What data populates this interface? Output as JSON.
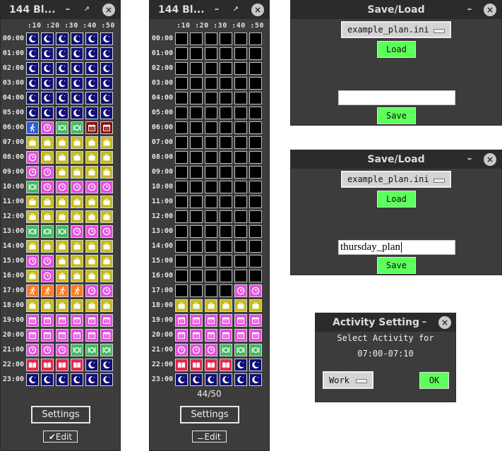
{
  "colors": {
    "sleep": "#0f0f7a",
    "work": "#c4bb1e",
    "free": "#e64fe0",
    "food": "#43b860",
    "exercise": "#ff7a22",
    "read": "#e8264f",
    "calendar": "#8a1010",
    "commute": "#2d5fd4",
    "empty": "#000000"
  },
  "activity_icons": {
    "sleep": "crescent-moon-icon",
    "work": "briefcase-icon",
    "free": "clock-icon",
    "food": "plate-icon",
    "exercise": "runner-icon",
    "read": "open-book-icon",
    "calendar": "calendar-icon",
    "commute": "walking-icon"
  },
  "left_window": {
    "title": "144 Bl...",
    "minimize": "–",
    "restore": "↗",
    "close": "×",
    "header": ":10 :20 :30 :40 :50",
    "settings_label": "Settings",
    "edit_label": "✔Edit",
    "rows": [
      {
        "hour": "00:00",
        "cells": [
          "sleep",
          "sleep",
          "sleep",
          "sleep",
          "sleep",
          "sleep"
        ]
      },
      {
        "hour": "01:00",
        "cells": [
          "sleep",
          "sleep",
          "sleep",
          "sleep",
          "sleep",
          "sleep"
        ]
      },
      {
        "hour": "02:00",
        "cells": [
          "sleep",
          "sleep",
          "sleep",
          "sleep",
          "sleep",
          "sleep"
        ]
      },
      {
        "hour": "03:00",
        "cells": [
          "sleep",
          "sleep",
          "sleep",
          "sleep",
          "sleep",
          "sleep"
        ]
      },
      {
        "hour": "04:00",
        "cells": [
          "sleep",
          "sleep",
          "sleep",
          "sleep",
          "sleep",
          "sleep"
        ]
      },
      {
        "hour": "05:00",
        "cells": [
          "sleep",
          "sleep",
          "sleep",
          "sleep",
          "sleep",
          "sleep"
        ]
      },
      {
        "hour": "06:00",
        "cells": [
          "commute",
          "free",
          "food",
          "food",
          "calendar",
          "calendar"
        ]
      },
      {
        "hour": "07:00",
        "cells": [
          "work",
          "work",
          "work",
          "work",
          "work",
          "work"
        ]
      },
      {
        "hour": "08:00",
        "cells": [
          "free",
          "work",
          "work",
          "work",
          "work",
          "work"
        ]
      },
      {
        "hour": "09:00",
        "cells": [
          "free",
          "free",
          "work",
          "work",
          "work",
          "work"
        ]
      },
      {
        "hour": "10:00",
        "cells": [
          "food",
          "free",
          "free",
          "free",
          "free",
          "free"
        ]
      },
      {
        "hour": "11:00",
        "cells": [
          "work",
          "work",
          "work",
          "work",
          "work",
          "work"
        ]
      },
      {
        "hour": "12:00",
        "cells": [
          "work",
          "work",
          "work",
          "work",
          "work",
          "work"
        ]
      },
      {
        "hour": "13:00",
        "cells": [
          "food",
          "food",
          "food",
          "free",
          "free",
          "free"
        ]
      },
      {
        "hour": "14:00",
        "cells": [
          "work",
          "work",
          "work",
          "work",
          "work",
          "work"
        ]
      },
      {
        "hour": "15:00",
        "cells": [
          "free",
          "free",
          "work",
          "work",
          "work",
          "work"
        ]
      },
      {
        "hour": "16:00",
        "cells": [
          "work",
          "free",
          "work",
          "work",
          "work",
          "work"
        ]
      },
      {
        "hour": "17:00",
        "cells": [
          "exercise",
          "exercise",
          "exercise",
          "exercise",
          "free",
          "free"
        ]
      },
      {
        "hour": "18:00",
        "cells": [
          "work",
          "work",
          "work",
          "work",
          "work",
          "work"
        ]
      },
      {
        "hour": "19:00",
        "cells": [
          "calendar-p",
          "calendar-p",
          "calendar-p",
          "calendar-p",
          "calendar-p",
          "calendar-p"
        ]
      },
      {
        "hour": "20:00",
        "cells": [
          "calendar-p",
          "calendar-p",
          "calendar-p",
          "calendar-p",
          "calendar-p",
          "calendar-p"
        ]
      },
      {
        "hour": "21:00",
        "cells": [
          "free",
          "free",
          "free",
          "food",
          "food",
          "food"
        ]
      },
      {
        "hour": "22:00",
        "cells": [
          "read",
          "read",
          "read",
          "read",
          "sleep",
          "sleep"
        ]
      },
      {
        "hour": "23:00",
        "cells": [
          "sleep",
          "sleep",
          "sleep",
          "sleep",
          "sleep",
          "sleep"
        ]
      }
    ]
  },
  "right_window": {
    "title": "144 Bl...",
    "minimize": "–",
    "restore": "↗",
    "close": "×",
    "header": ":10 :20 :30 :40 :50",
    "counter": "44/50",
    "settings_label": "Settings",
    "edit_label": "Edit",
    "rows": [
      {
        "hour": "00:00",
        "cells": [
          "empty",
          "empty",
          "empty",
          "empty",
          "empty",
          "empty"
        ]
      },
      {
        "hour": "01:00",
        "cells": [
          "empty",
          "empty",
          "empty",
          "empty",
          "empty",
          "empty"
        ]
      },
      {
        "hour": "02:00",
        "cells": [
          "empty",
          "empty",
          "empty",
          "empty",
          "empty",
          "empty"
        ]
      },
      {
        "hour": "03:00",
        "cells": [
          "empty",
          "empty",
          "empty",
          "empty",
          "empty",
          "empty"
        ]
      },
      {
        "hour": "04:00",
        "cells": [
          "empty",
          "empty",
          "empty",
          "empty",
          "empty",
          "empty"
        ]
      },
      {
        "hour": "05:00",
        "cells": [
          "empty",
          "empty",
          "empty",
          "empty",
          "empty",
          "empty"
        ]
      },
      {
        "hour": "06:00",
        "cells": [
          "empty",
          "empty",
          "empty",
          "empty",
          "empty",
          "empty"
        ]
      },
      {
        "hour": "07:00",
        "cells": [
          "empty",
          "empty",
          "empty",
          "empty",
          "empty",
          "empty"
        ]
      },
      {
        "hour": "08:00",
        "cells": [
          "empty",
          "empty",
          "empty",
          "empty",
          "empty",
          "empty"
        ]
      },
      {
        "hour": "09:00",
        "cells": [
          "empty",
          "empty",
          "empty",
          "empty",
          "empty",
          "empty"
        ]
      },
      {
        "hour": "10:00",
        "cells": [
          "empty",
          "empty",
          "empty",
          "empty",
          "empty",
          "empty"
        ]
      },
      {
        "hour": "11:00",
        "cells": [
          "empty",
          "empty",
          "empty",
          "empty",
          "empty",
          "empty"
        ]
      },
      {
        "hour": "12:00",
        "cells": [
          "empty",
          "empty",
          "empty",
          "empty",
          "empty",
          "empty"
        ]
      },
      {
        "hour": "13:00",
        "cells": [
          "empty",
          "empty",
          "empty",
          "empty",
          "empty",
          "empty"
        ]
      },
      {
        "hour": "14:00",
        "cells": [
          "empty",
          "empty",
          "empty",
          "empty",
          "empty",
          "empty"
        ]
      },
      {
        "hour": "15:00",
        "cells": [
          "empty",
          "empty",
          "empty",
          "empty",
          "empty",
          "empty"
        ]
      },
      {
        "hour": "16:00",
        "cells": [
          "empty",
          "empty",
          "empty",
          "empty",
          "empty",
          "empty"
        ]
      },
      {
        "hour": "17:00",
        "cells": [
          "empty",
          "empty",
          "empty",
          "empty",
          "free",
          "free"
        ]
      },
      {
        "hour": "18:00",
        "cells": [
          "work",
          "work",
          "work",
          "work",
          "work",
          "work"
        ]
      },
      {
        "hour": "19:00",
        "cells": [
          "calendar-p",
          "calendar-p",
          "calendar-p",
          "calendar-p",
          "calendar-p",
          "calendar-p"
        ]
      },
      {
        "hour": "20:00",
        "cells": [
          "calendar-p",
          "calendar-p",
          "calendar-p",
          "calendar-p",
          "calendar-p",
          "calendar-p"
        ]
      },
      {
        "hour": "21:00",
        "cells": [
          "free",
          "free",
          "free",
          "food",
          "food",
          "food"
        ]
      },
      {
        "hour": "22:00",
        "cells": [
          "read",
          "read",
          "read",
          "read",
          "sleep",
          "sleep"
        ]
      },
      {
        "hour": "23:00",
        "cells": [
          "sleep",
          "sleep",
          "sleep",
          "sleep",
          "sleep",
          "sleep"
        ]
      }
    ]
  },
  "saveload_top": {
    "title": "Save/Load",
    "minimize": "–",
    "close": "×",
    "selected_file": "example_plan.ini",
    "load_label": "Load",
    "filename_value": "",
    "save_label": "Save"
  },
  "saveload_bottom": {
    "title": "Save/Load",
    "minimize": "–",
    "close": "×",
    "selected_file": "example_plan.ini",
    "load_label": "Load",
    "filename_value": "thursday_plan",
    "save_label": "Save"
  },
  "activity_dialog": {
    "title": "Activity Setting",
    "minimize": "–",
    "close": "×",
    "prompt": "Select Activity for",
    "time_range": "07:00-07:10",
    "selected_activity": "Work",
    "ok_label": "OK"
  }
}
